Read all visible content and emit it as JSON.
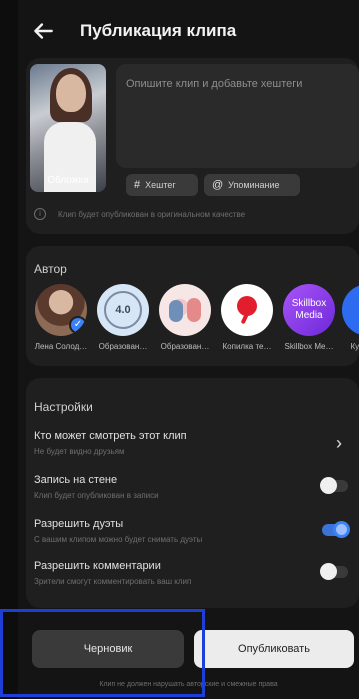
{
  "header": {
    "title": "Публикация клипа"
  },
  "publication": {
    "cover_label": "Обложка",
    "description_placeholder": "Опишите клип и добавьте хештеги",
    "hashtag_chip": "Хештег",
    "mention_chip": "Упоминание",
    "quality_note": "Клип будет опубликован в оригинальном качестве"
  },
  "author": {
    "label": "Автор",
    "items": [
      {
        "name": "Лена Солод…",
        "selected": true
      },
      {
        "name": "Образован…",
        "badge": "4.0"
      },
      {
        "name": "Образован…"
      },
      {
        "name": "Копилка те…"
      },
      {
        "name": "Skillbox Me…",
        "logo_text": "Skillbox Media"
      },
      {
        "name": "Кур"
      }
    ]
  },
  "settings": {
    "label": "Настройки",
    "rows": [
      {
        "title": "Кто может смотреть этот клип",
        "subtitle": "Не будет видно друзьям",
        "control": "chevron"
      },
      {
        "title": "Запись на стене",
        "subtitle": "Клип будет опубликован в записи",
        "control": "toggle",
        "on": false
      },
      {
        "title": "Разрешить дуэты",
        "subtitle": "С вашим клипом можно будет снимать дуэты",
        "control": "toggle",
        "on": true
      },
      {
        "title": "Разрешить комментарии",
        "subtitle": "Зрители смогут комментировать ваш клип",
        "control": "toggle",
        "on": false
      }
    ]
  },
  "actions": {
    "draft": "Черновик",
    "publish": "Опубликовать",
    "legal": "Клип не должен нарушать авторские и смежные права"
  },
  "colors": {
    "accent": "#3b82f6",
    "highlight_border": "#1d3fd6"
  }
}
